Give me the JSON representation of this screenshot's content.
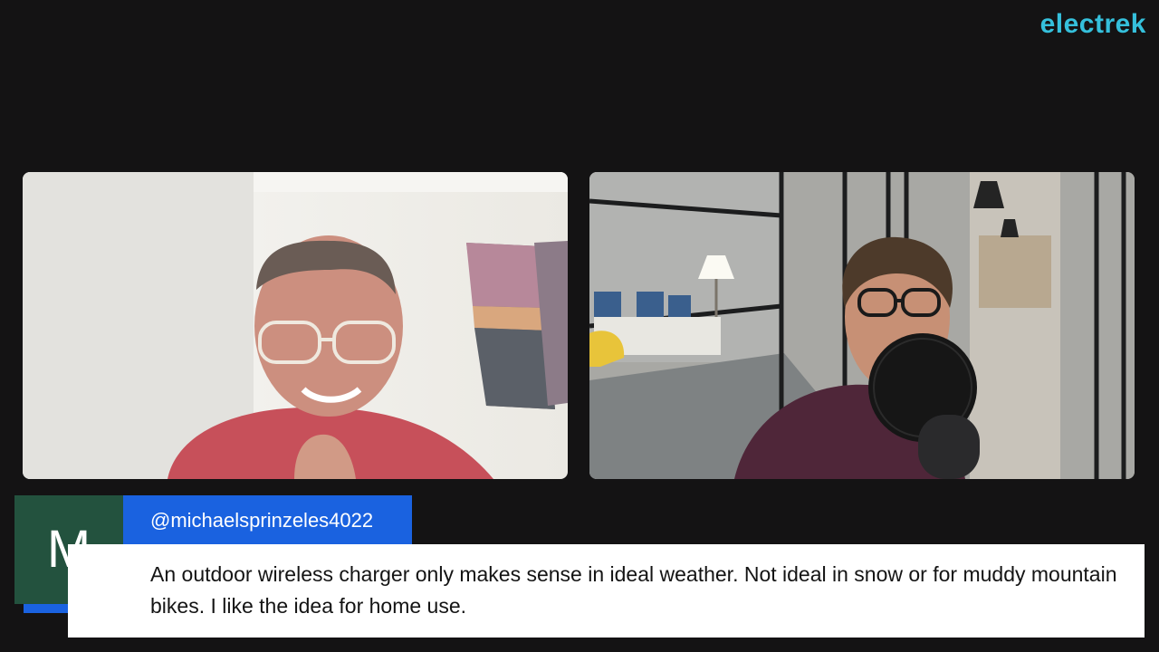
{
  "brand": {
    "logo_text": "electrek",
    "logo_color": "#35c0dc"
  },
  "participants": [
    {
      "position": "left",
      "scene": "man with glasses in pink shirt, beach painting on wall"
    },
    {
      "position": "right",
      "scene": "man with glasses and microphone in office corridor"
    }
  ],
  "comment": {
    "avatar_letter": "M",
    "avatar_color": "#23523e",
    "platform_icon": "youtube-icon",
    "username": "@michaelsprinzeles4022",
    "text": "An outdoor wireless charger only makes sense in ideal weather. Not ideal in snow or for muddy mountain bikes. I like the idea for home use.",
    "accent_color": "#1a62e0"
  }
}
